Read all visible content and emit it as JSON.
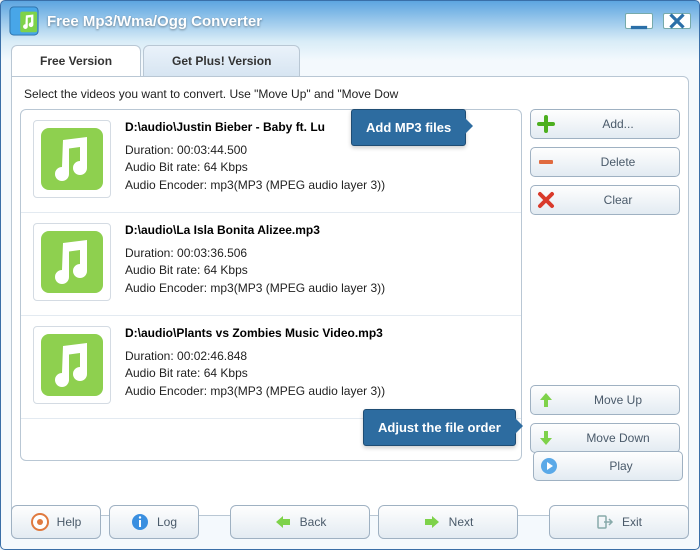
{
  "app": {
    "title": "Free Mp3/Wma/Ogg Converter"
  },
  "tabs": {
    "free": "Free Version",
    "plus": "Get Plus! Version"
  },
  "instruction": "Select the videos you want to convert. Use \"Move Up\" and \"Move Dow",
  "files": [
    {
      "path": "D:\\audio\\Justin Bieber - Baby ft. Lu",
      "duration": "Duration: 00:03:44.500",
      "bitrate": "Audio Bit rate: 64 Kbps",
      "encoder": "Audio Encoder: mp3(MP3 (MPEG audio layer 3))"
    },
    {
      "path": "D:\\audio\\La Isla Bonita Alizee.mp3",
      "duration": "Duration: 00:03:36.506",
      "bitrate": "Audio Bit rate: 64 Kbps",
      "encoder": "Audio Encoder: mp3(MP3 (MPEG audio layer 3))"
    },
    {
      "path": "D:\\audio\\Plants vs Zombies Music Video.mp3",
      "duration": "Duration: 00:02:46.848",
      "bitrate": "Audio Bit rate: 64 Kbps",
      "encoder": "Audio Encoder: mp3(MP3 (MPEG audio layer 3))"
    }
  ],
  "side": {
    "add": "Add...",
    "delete": "Delete",
    "clear": "Clear",
    "moveup": "Move Up",
    "movedown": "Move Down",
    "play": "Play"
  },
  "callouts": {
    "add": "Add MP3 files",
    "order": "Adjust the file order"
  },
  "footer": {
    "help": "Help",
    "log": "Log",
    "back": "Back",
    "next": "Next",
    "exit": "Exit"
  },
  "colors": {
    "accent": "#2d6ca0"
  }
}
